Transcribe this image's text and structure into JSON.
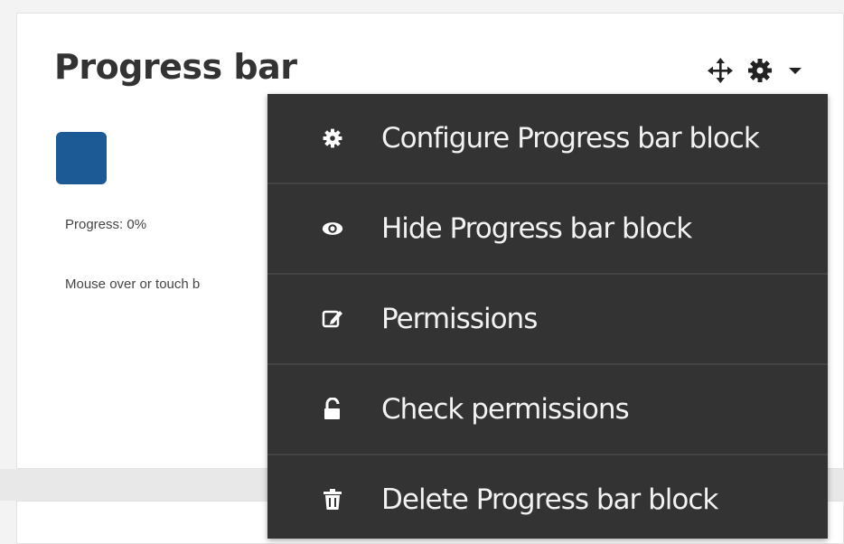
{
  "block": {
    "title": "Progress bar",
    "progress_label": "Progress: 0%",
    "instruction": "Mouse over or touch b",
    "progress_square_color": "#1b5a94"
  },
  "header_icons": [
    "move-icon",
    "gear-icon",
    "caret-down-icon"
  ],
  "menu": {
    "items": [
      {
        "label": "Configure Progress bar block",
        "icon": "gear-icon"
      },
      {
        "label": "Hide Progress bar block",
        "icon": "eye-icon"
      },
      {
        "label": "Permissions",
        "icon": "edit-icon"
      },
      {
        "label": "Check permissions",
        "icon": "unlock-icon"
      },
      {
        "label": "Delete Progress bar block",
        "icon": "trash-icon"
      }
    ]
  },
  "colors": {
    "menu_background": "#333333",
    "menu_text": "#f2f2f2",
    "title_text": "#333333"
  }
}
